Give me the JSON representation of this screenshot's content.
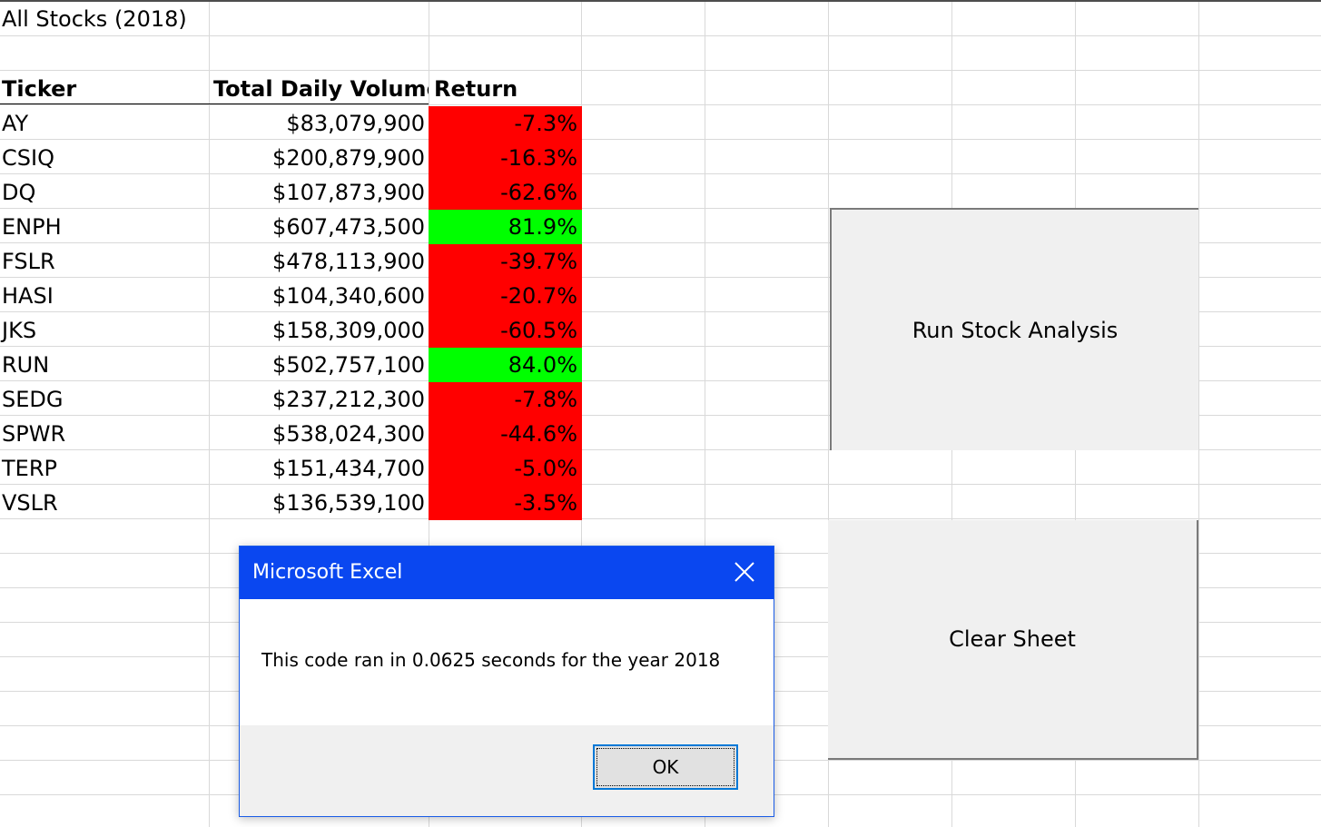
{
  "sheet": {
    "title": "All Stocks (2018)",
    "headers": {
      "ticker": "Ticker",
      "volume": "Total Daily Volume",
      "return": "Return"
    },
    "rows": [
      {
        "ticker": "AY",
        "volume": "$83,079,900",
        "return": "-7.3%",
        "positive": false
      },
      {
        "ticker": "CSIQ",
        "volume": "$200,879,900",
        "return": "-16.3%",
        "positive": false
      },
      {
        "ticker": "DQ",
        "volume": "$107,873,900",
        "return": "-62.6%",
        "positive": false
      },
      {
        "ticker": "ENPH",
        "volume": "$607,473,500",
        "return": "81.9%",
        "positive": true
      },
      {
        "ticker": "FSLR",
        "volume": "$478,113,900",
        "return": "-39.7%",
        "positive": false
      },
      {
        "ticker": "HASI",
        "volume": "$104,340,600",
        "return": "-20.7%",
        "positive": false
      },
      {
        "ticker": "JKS",
        "volume": "$158,309,000",
        "return": "-60.5%",
        "positive": false
      },
      {
        "ticker": "RUN",
        "volume": "$502,757,100",
        "return": "84.0%",
        "positive": true
      },
      {
        "ticker": "SEDG",
        "volume": "$237,212,300",
        "return": "-7.8%",
        "positive": false
      },
      {
        "ticker": "SPWR",
        "volume": "$538,024,300",
        "return": "-44.6%",
        "positive": false
      },
      {
        "ticker": "TERP",
        "volume": "$151,434,700",
        "return": "-5.0%",
        "positive": false
      },
      {
        "ticker": "VSLR",
        "volume": "$136,539,100",
        "return": "-3.5%",
        "positive": false
      }
    ]
  },
  "buttons": {
    "run": "Run Stock Analysis",
    "clear": "Clear Sheet"
  },
  "dialog": {
    "title": "Microsoft Excel",
    "message": "This code ran in 0.0625 seconds for the year 2018",
    "ok": "OK"
  },
  "colors": {
    "positive": "#00ff00",
    "negative": "#ff0000",
    "dialog_titlebar": "#0a47f0"
  },
  "icons": {
    "close": "close-icon"
  }
}
